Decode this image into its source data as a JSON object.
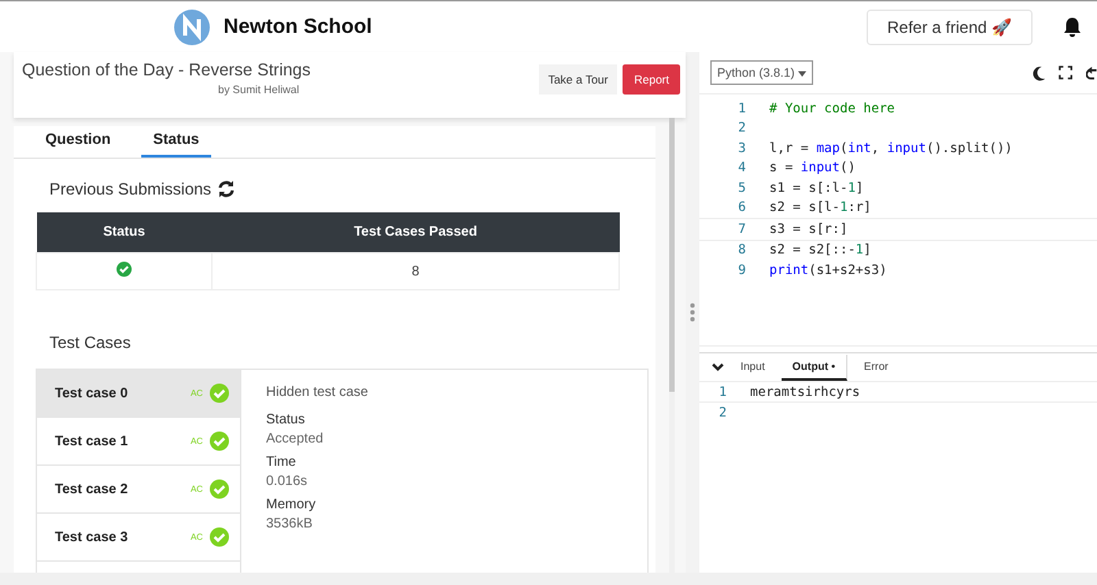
{
  "header": {
    "brand": "Newton School",
    "refer_button": "Refer a friend 🚀"
  },
  "question": {
    "title": "Question of the Day - Reverse Strings",
    "author": "by Sumit Heliwal",
    "tour_button": "Take a Tour",
    "report_button": "Report"
  },
  "tabs": [
    {
      "label": "Question",
      "selected": false
    },
    {
      "label": "Status",
      "selected": true
    }
  ],
  "submissions": {
    "heading": "Previous Submissions",
    "columns": [
      "Status",
      "Test Cases Passed"
    ],
    "rows": [
      {
        "passed": true,
        "test_cases_passed": "8"
      }
    ]
  },
  "test_cases": {
    "heading": "Test Cases",
    "items": [
      {
        "label": "Test case 0",
        "verdict": "AC",
        "selected": true
      },
      {
        "label": "Test case 1",
        "verdict": "AC",
        "selected": false
      },
      {
        "label": "Test case 2",
        "verdict": "AC",
        "selected": false
      },
      {
        "label": "Test case 3",
        "verdict": "AC",
        "selected": false
      }
    ],
    "detail": {
      "note": "Hidden test case",
      "fields": [
        {
          "label": "Status",
          "value": "Accepted"
        },
        {
          "label": "Time",
          "value": "0.016s"
        },
        {
          "label": "Memory",
          "value": "3536kB"
        }
      ]
    }
  },
  "editor": {
    "language": "Python (3.8.1)",
    "lines": [
      {
        "number": "1",
        "tokens": [
          {
            "text": "# Your code here",
            "kind": "comment"
          }
        ]
      },
      {
        "number": "2"
      },
      {
        "number": "3",
        "tokens": [
          {
            "text": "l,r = ",
            "kind": "plain"
          },
          {
            "text": "map",
            "kind": "builtin"
          },
          {
            "text": "(",
            "kind": "plain"
          },
          {
            "text": "int",
            "kind": "builtin"
          },
          {
            "text": ", ",
            "kind": "plain"
          },
          {
            "text": "input",
            "kind": "builtin"
          },
          {
            "text": "().split())",
            "kind": "plain"
          }
        ]
      },
      {
        "number": "4",
        "tokens": [
          {
            "text": "s = ",
            "kind": "plain"
          },
          {
            "text": "input",
            "kind": "builtin"
          },
          {
            "text": "()",
            "kind": "plain"
          }
        ]
      },
      {
        "number": "5",
        "tokens": [
          {
            "text": "s1 = s[:l-",
            "kind": "plain"
          },
          {
            "text": "1",
            "kind": "number"
          },
          {
            "text": "]",
            "kind": "plain"
          }
        ]
      },
      {
        "number": "6",
        "tokens": [
          {
            "text": "s2 = s[l-",
            "kind": "plain"
          },
          {
            "text": "1",
            "kind": "number"
          },
          {
            "text": ":r]",
            "kind": "plain"
          }
        ]
      },
      {
        "number": "7",
        "tokens": [
          {
            "text": "s3 = s[r:]",
            "kind": "plain"
          }
        ]
      },
      {
        "number": "8",
        "tokens": [
          {
            "text": "s2 = s2[::-",
            "kind": "plain"
          },
          {
            "text": "1",
            "kind": "number"
          },
          {
            "text": "]",
            "kind": "plain"
          }
        ]
      },
      {
        "number": "9",
        "tokens": [
          {
            "text": "print",
            "kind": "builtin"
          },
          {
            "text": "(s1+s2+s3)",
            "kind": "plain"
          }
        ]
      }
    ]
  },
  "console": {
    "tabs": [
      {
        "label": "Input",
        "selected": false
      },
      {
        "label": "Output •",
        "selected": true
      },
      {
        "label": "Error",
        "selected": false
      }
    ],
    "lines": [
      {
        "number": "1",
        "text": "meramtsirhcyrs"
      },
      {
        "number": "2"
      }
    ]
  }
}
